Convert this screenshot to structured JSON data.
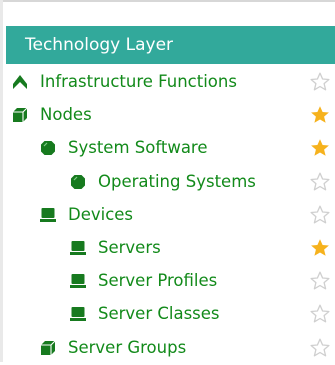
{
  "header": {
    "title": "Technology Layer"
  },
  "colors": {
    "header_bg": "#32a99b",
    "label_text": "#128a1a",
    "icon_fill": "#177a1f",
    "star_filled": "#f6b21d",
    "star_empty_outline": "#cfcfcf"
  },
  "tree": [
    {
      "label": "Infrastructure Functions",
      "icon": "upward-chevron-icon",
      "level": 0,
      "favorite": false
    },
    {
      "label": "Nodes",
      "icon": "3d-box-icon",
      "level": 0,
      "favorite": true
    },
    {
      "label": "System Software",
      "icon": "disc-icon",
      "level": 1,
      "favorite": true
    },
    {
      "label": "Operating Systems",
      "icon": "disc-icon",
      "level": 2,
      "favorite": false
    },
    {
      "label": "Devices",
      "icon": "device-icon",
      "level": 1,
      "favorite": false
    },
    {
      "label": "Servers",
      "icon": "device-icon",
      "level": 2,
      "favorite": true
    },
    {
      "label": "Server Profiles",
      "icon": "device-icon",
      "level": 2,
      "favorite": false
    },
    {
      "label": "Server Classes",
      "icon": "device-icon",
      "level": 2,
      "favorite": false
    },
    {
      "label": "Server Groups",
      "icon": "3d-box-icon",
      "level": 1,
      "favorite": false
    }
  ]
}
